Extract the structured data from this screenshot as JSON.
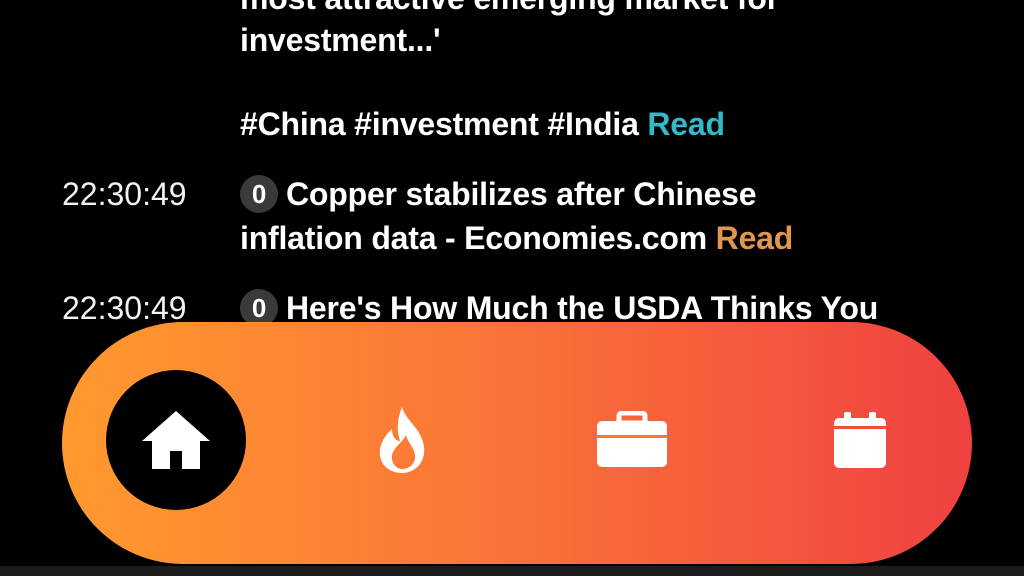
{
  "feed": {
    "item1": {
      "line1": "most attractive emerging market for",
      "line2": "investment...'",
      "tags": "#China #investment #India",
      "read_label": "Read"
    },
    "item2": {
      "time": "22:30:49",
      "count": "0",
      "line1": "Copper stabilizes after Chinese",
      "line2": "inflation data - Economies.com",
      "read_label": "Read"
    },
    "item3": {
      "time": "22:30:49",
      "count": "0",
      "line1": "Here's How Much the USDA Thinks You"
    }
  },
  "nav": {
    "items": [
      {
        "icon": "home-icon",
        "active": true
      },
      {
        "icon": "fire-icon",
        "active": false
      },
      {
        "icon": "briefcase-icon",
        "active": false
      },
      {
        "icon": "calendar-icon",
        "active": false
      }
    ],
    "gradient_start": "#ff9a2e",
    "gradient_end": "#ef4141"
  },
  "colors": {
    "read_teal": "#33b9c9",
    "read_orange": "#e0964e",
    "badge_bg": "#3a3a3a",
    "background": "#000000"
  }
}
